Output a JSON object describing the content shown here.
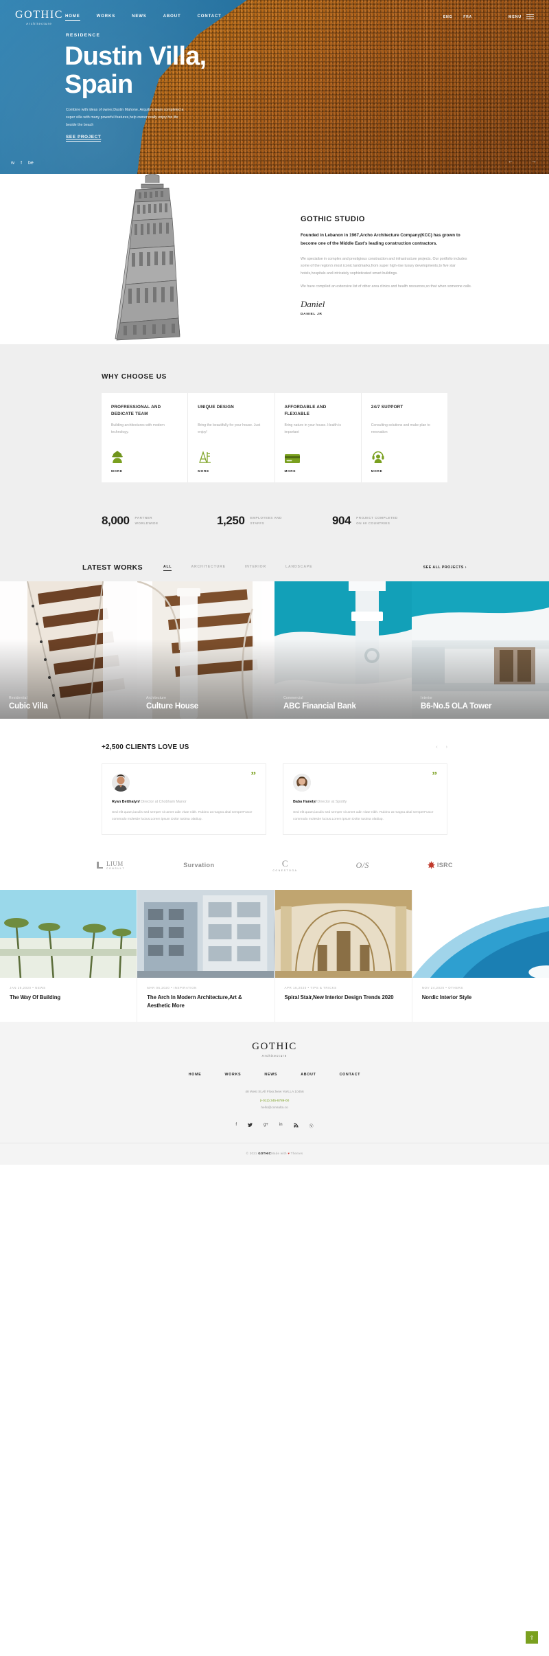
{
  "brand": {
    "name": "GOTHIC",
    "tagline": "Architecture",
    "accent": "#7aa01f",
    "hero_blue": "#1f6f9f",
    "brick": "#c8761a"
  },
  "header": {
    "menu": [
      {
        "label": "HOME",
        "active": true
      },
      {
        "label": "WORKS",
        "active": false
      },
      {
        "label": "NEWS",
        "active": false
      },
      {
        "label": "ABOUT",
        "active": false
      },
      {
        "label": "CONTACT",
        "active": false
      }
    ],
    "languages": [
      {
        "label": "ENG",
        "selected": true
      },
      {
        "label": "FRA",
        "selected": false
      }
    ],
    "menu_button_label": "MENU",
    "menu_icon": "hamburger-icon"
  },
  "hero": {
    "kicker": "RESIDENCE",
    "title_line1": "Dustin Villa,",
    "title_line2": "Spain",
    "copy": "Combine with ideas of owner,Dustin Mahone. Arquito's team completed a super villa with many powerful features,help owner really enjoy his life beside the beach",
    "cta": "SEE PROJECT",
    "social": [
      "twitter-icon",
      "facebook-icon",
      "behance-icon"
    ],
    "prev_icon": "arrow-left-icon",
    "next_icon": "arrow-right-icon"
  },
  "studio": {
    "heading": "GOTHIC STUDIO",
    "lead": "Founded in Lebanon in 1967,Archo Architecture Company(KCC) has grown to become one of the Middle East's leading construction contractors.",
    "paragraph1": "We specialise in complex and prestigious construction and infrastructure projects. Our portfolio includes some of the region's most iconic landmarks,from super high-rise luxury developments,to five star hotels,hospitals and intricately sophisticated smart buildings.",
    "paragraph2": "We have compiled an extensive list of other area clinics and health resources,so that when someone calls.",
    "signature": "Daniel",
    "signature_name": "DANIEL JR"
  },
  "why": {
    "heading": "WHY CHOOSE US",
    "cards": [
      {
        "title": "PROFRESSIONAL AND DEDICATE TEAM",
        "text": "Building architectures with modern technology.",
        "icon": "worker-helmet-icon",
        "more": "MORE"
      },
      {
        "title": "UNIQUE DESIGN",
        "text": "Bring the beautifully for your house. Just enjoy!",
        "icon": "drafting-tools-icon",
        "more": "MORE"
      },
      {
        "title": "AFFORDABLE AND FLEXIABLE",
        "text": "Bring nature in your house. Health is important",
        "icon": "credit-card-icon",
        "more": "MORE"
      },
      {
        "title": "24/7 SUPPORT",
        "text": "Consulting solutions and make plan to renovation",
        "icon": "headset-support-icon",
        "more": "MORE"
      }
    ]
  },
  "stats": [
    {
      "number": "8,000",
      "label_line1": "PARTNER",
      "label_line2": "WORLDWIDE"
    },
    {
      "number": "1,250",
      "label_line1": "EMPLOYEES AND",
      "label_line2": "STAFFS"
    },
    {
      "number": "904",
      "label_line1": "PROJECT COMPLETED",
      "label_line2": "ON 60 COUNTRIES"
    }
  ],
  "latest_works": {
    "heading": "LATEST WORKS",
    "filters": [
      {
        "label": "ALL",
        "active": true
      },
      {
        "label": "ARCHITECTURE",
        "active": false
      },
      {
        "label": "INTERIOR",
        "active": false
      },
      {
        "label": "LANDSCAPE",
        "active": false
      }
    ],
    "see_all": "SEE ALL PROJECTS  ›",
    "items": [
      {
        "category": "Residential",
        "title": "Cubic Villa"
      },
      {
        "category": "Architecture",
        "title": "Culture House"
      },
      {
        "category": "Commercial",
        "title": "ABC Financial Bank"
      },
      {
        "category": "Interior",
        "title": "B6-No.5 OLA Tower"
      }
    ]
  },
  "testimonials": {
    "heading": "+2,500 CLIENTS LOVE US",
    "prev_icon": "chevron-left-icon",
    "next_icon": "chevron-right-icon",
    "items": [
      {
        "name": "Ryan Betthalyn/",
        "role": "Director at Chobham Manor",
        "text": "Sed elit quam,iaculis sed semper sit amet udin vitae nibh. Rubino at magna akal semperFusce commodo molestie luctus.Lorem ipsum Dolor tusima olatiiup.",
        "quote_icon": "quote-mark-icon"
      },
      {
        "name": "Baba Hanely/",
        "role": "Director at Spotify",
        "text": "Sed elit quam,iaculis sed semper sit amet udin vitae nibh. Rubino at magna akal semperFusce commodo molestie luctus.Lorem ipsum Dolor tusima olatiiup.",
        "quote_icon": "quote-mark-icon"
      }
    ]
  },
  "client_logos": [
    {
      "main": "LIUM",
      "sub": "CONSULT"
    },
    {
      "main": "Survation",
      "sub": ""
    },
    {
      "main": "C",
      "sub": "CONESTOGA"
    },
    {
      "main": "O/S",
      "sub": ""
    },
    {
      "main": "ISRC",
      "sub": ""
    }
  ],
  "blog": [
    {
      "meta": "JAN 28,2020  •  NEWS",
      "title": "The Way Of Building",
      "image": "palm-trees-photo"
    },
    {
      "meta": "MAR 06,2020  •  INSPIRATION",
      "title": "The Arch In Modern Architecture,Art & Aesthetic More",
      "image": "modern-facade-photo"
    },
    {
      "meta": "APR 16,2020  •  TIPS & TRICKS",
      "title": "Spiral Stair,New Interior Design Trends 2020",
      "image": "ornate-hall-photo"
    },
    {
      "meta": "NOV 24,2020  •  OTHERS",
      "title": "Nordic Interior Style",
      "image": "curved-blue-roof-photo"
    }
  ],
  "footer": {
    "menu": [
      "HOME",
      "WORKS",
      "NEWS",
      "ABOUT",
      "CONTACT"
    ],
    "address": "48 West St,All Floor,New York,LA 10456",
    "phone": "(+012) 345-6789-00",
    "email": "hello@consulta.co",
    "social": [
      "facebook-icon",
      "twitter-icon",
      "google-plus-icon",
      "linkedin-icon",
      "rss-icon",
      "pinterest-icon"
    ],
    "copyright_pre": "© 2021 ",
    "copyright_brand": "GOTHIC",
    "copyright_mid": "Made with ",
    "copyright_heart": "♥",
    "copyright_post": " Themes",
    "back_to_top_icon": "arrow-up-icon"
  }
}
